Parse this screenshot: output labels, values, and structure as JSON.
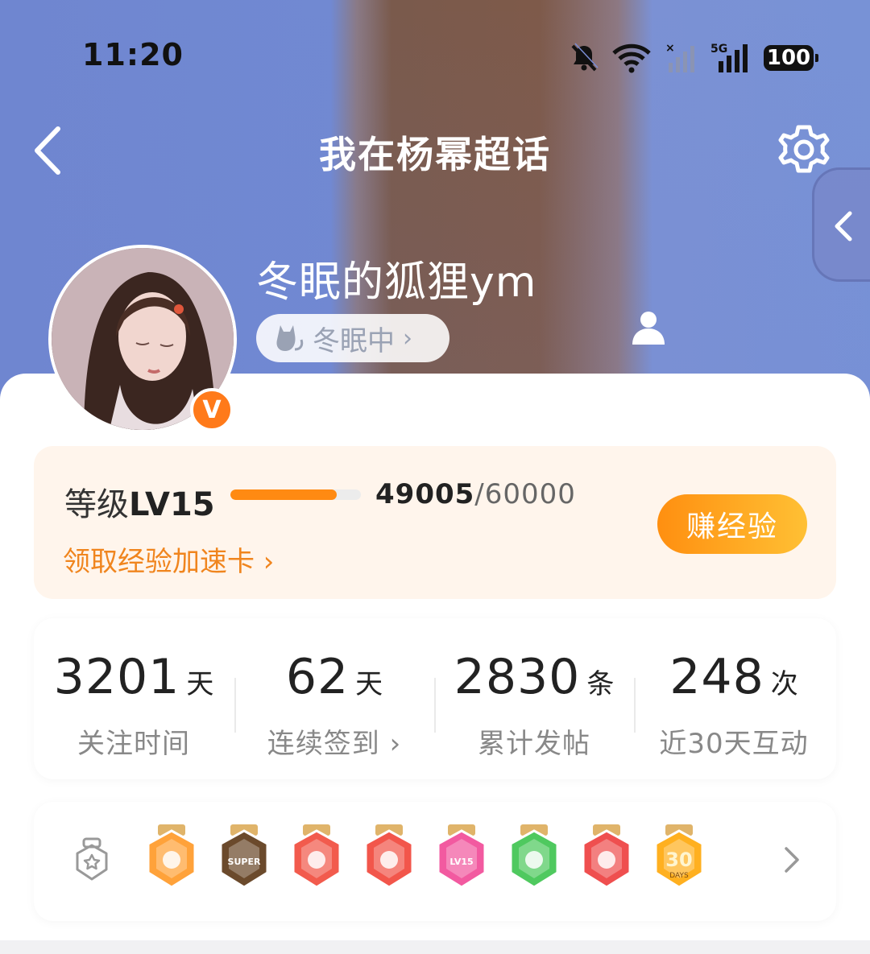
{
  "status_bar": {
    "time": "11:20",
    "network_label": "5G",
    "battery": "100"
  },
  "nav": {
    "title": "我在杨幂超话"
  },
  "profile": {
    "username": "冬眠的狐狸ym",
    "verify_badge": "V",
    "status": "冬眠中",
    "status_arrow": "›"
  },
  "level": {
    "label_prefix": "等级",
    "level": "LV15",
    "current_exp": "49005",
    "separator": "/",
    "max_exp": "60000",
    "progress_fraction": 0.817,
    "accelerate_link": "领取经验加速卡 ›",
    "earn_button": "赚经验"
  },
  "stats": [
    {
      "value": "3201",
      "unit": "天",
      "label": "关注时间"
    },
    {
      "value": "62",
      "unit": "天",
      "label": "连续签到 ›"
    },
    {
      "value": "2830",
      "unit": "条",
      "label": "累计发帖"
    },
    {
      "value": "248",
      "unit": "次",
      "label": "近30天互动"
    }
  ],
  "badges": [
    {
      "name": "crown-badge",
      "color": "#ffa23a",
      "text": ""
    },
    {
      "name": "super-badge",
      "color": "#6b4a2c",
      "text": "SUPER"
    },
    {
      "name": "cat-badge",
      "color": "#f25b4d",
      "text": ""
    },
    {
      "name": "rabbit-badge",
      "color": "#f2564b",
      "text": ""
    },
    {
      "name": "lv15-badge",
      "color": "#f25aa0",
      "text": "LV15"
    },
    {
      "name": "hand-badge",
      "color": "#4fc95f",
      "text": ""
    },
    {
      "name": "trophy-badge",
      "color": "#ef4f4f",
      "text": ""
    },
    {
      "name": "30days-badge",
      "color": "#ffb020",
      "text": "30"
    }
  ],
  "badge_30_sub": "DAYS",
  "colors": {
    "accent_orange": "#ff8a12",
    "link_orange": "#f0851e"
  }
}
